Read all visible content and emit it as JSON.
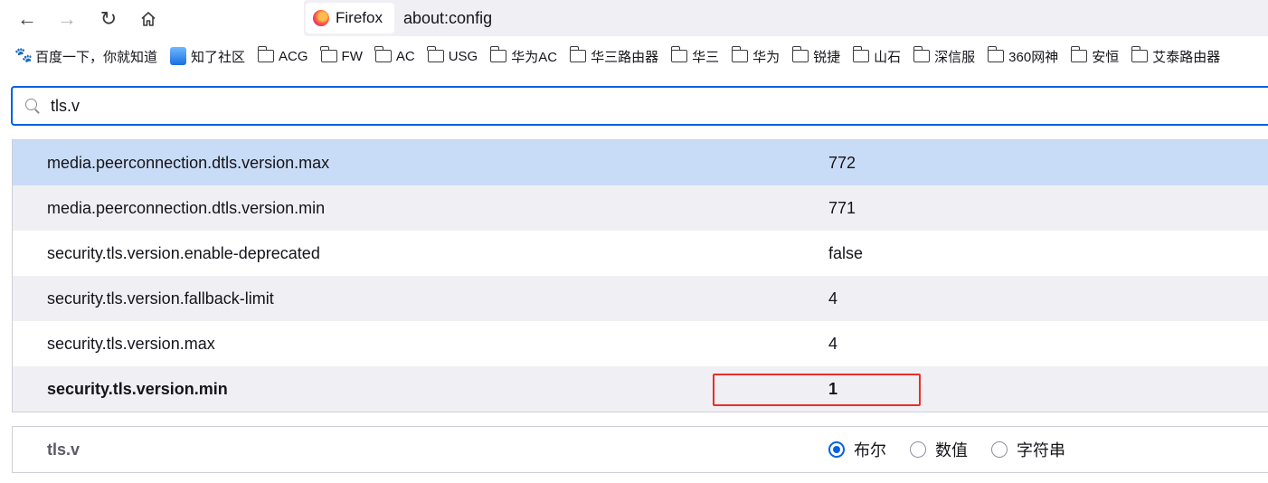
{
  "toolbar": {
    "back_icon": "back-arrow-icon",
    "forward_icon": "forward-arrow-icon",
    "reload_icon": "reload-icon",
    "home_icon": "home-icon",
    "identity_label": "Firefox",
    "url": "about:config"
  },
  "bookmarks": [
    {
      "label": "百度一下，你就知道",
      "icon": "baidu-paw-icon"
    },
    {
      "label": "知了社区",
      "icon": "zhiliao-drop-icon"
    },
    {
      "label": "ACG",
      "icon": "folder-icon"
    },
    {
      "label": "FW",
      "icon": "folder-icon"
    },
    {
      "label": "AC",
      "icon": "folder-icon"
    },
    {
      "label": "USG",
      "icon": "folder-icon"
    },
    {
      "label": "华为AC",
      "icon": "folder-icon"
    },
    {
      "label": "华三路由器",
      "icon": "folder-icon"
    },
    {
      "label": "华三",
      "icon": "folder-icon"
    },
    {
      "label": "华为",
      "icon": "folder-icon"
    },
    {
      "label": "锐捷",
      "icon": "folder-icon"
    },
    {
      "label": "山石",
      "icon": "folder-icon"
    },
    {
      "label": "深信服",
      "icon": "folder-icon"
    },
    {
      "label": "360网神",
      "icon": "folder-icon"
    },
    {
      "label": "安恒",
      "icon": "folder-icon"
    },
    {
      "label": "艾泰路由器",
      "icon": "folder-icon"
    }
  ],
  "search": {
    "value": "tls.v"
  },
  "prefs": [
    {
      "name": "media.peerconnection.dtls.version.max",
      "value": "772"
    },
    {
      "name": "media.peerconnection.dtls.version.min",
      "value": "771"
    },
    {
      "name": "security.tls.version.enable-deprecated",
      "value": "false"
    },
    {
      "name": "security.tls.version.fallback-limit",
      "value": "4"
    },
    {
      "name": "security.tls.version.max",
      "value": "4"
    },
    {
      "name": "security.tls.version.min",
      "value": "1"
    }
  ],
  "new_pref": {
    "name": "tls.v",
    "types": [
      "布尔",
      "数值",
      "字符串"
    ],
    "selected": "布尔"
  },
  "colors": {
    "accent": "#0061e0",
    "selected_row": "#c9dcf7",
    "highlight_box": "#e8302a"
  }
}
